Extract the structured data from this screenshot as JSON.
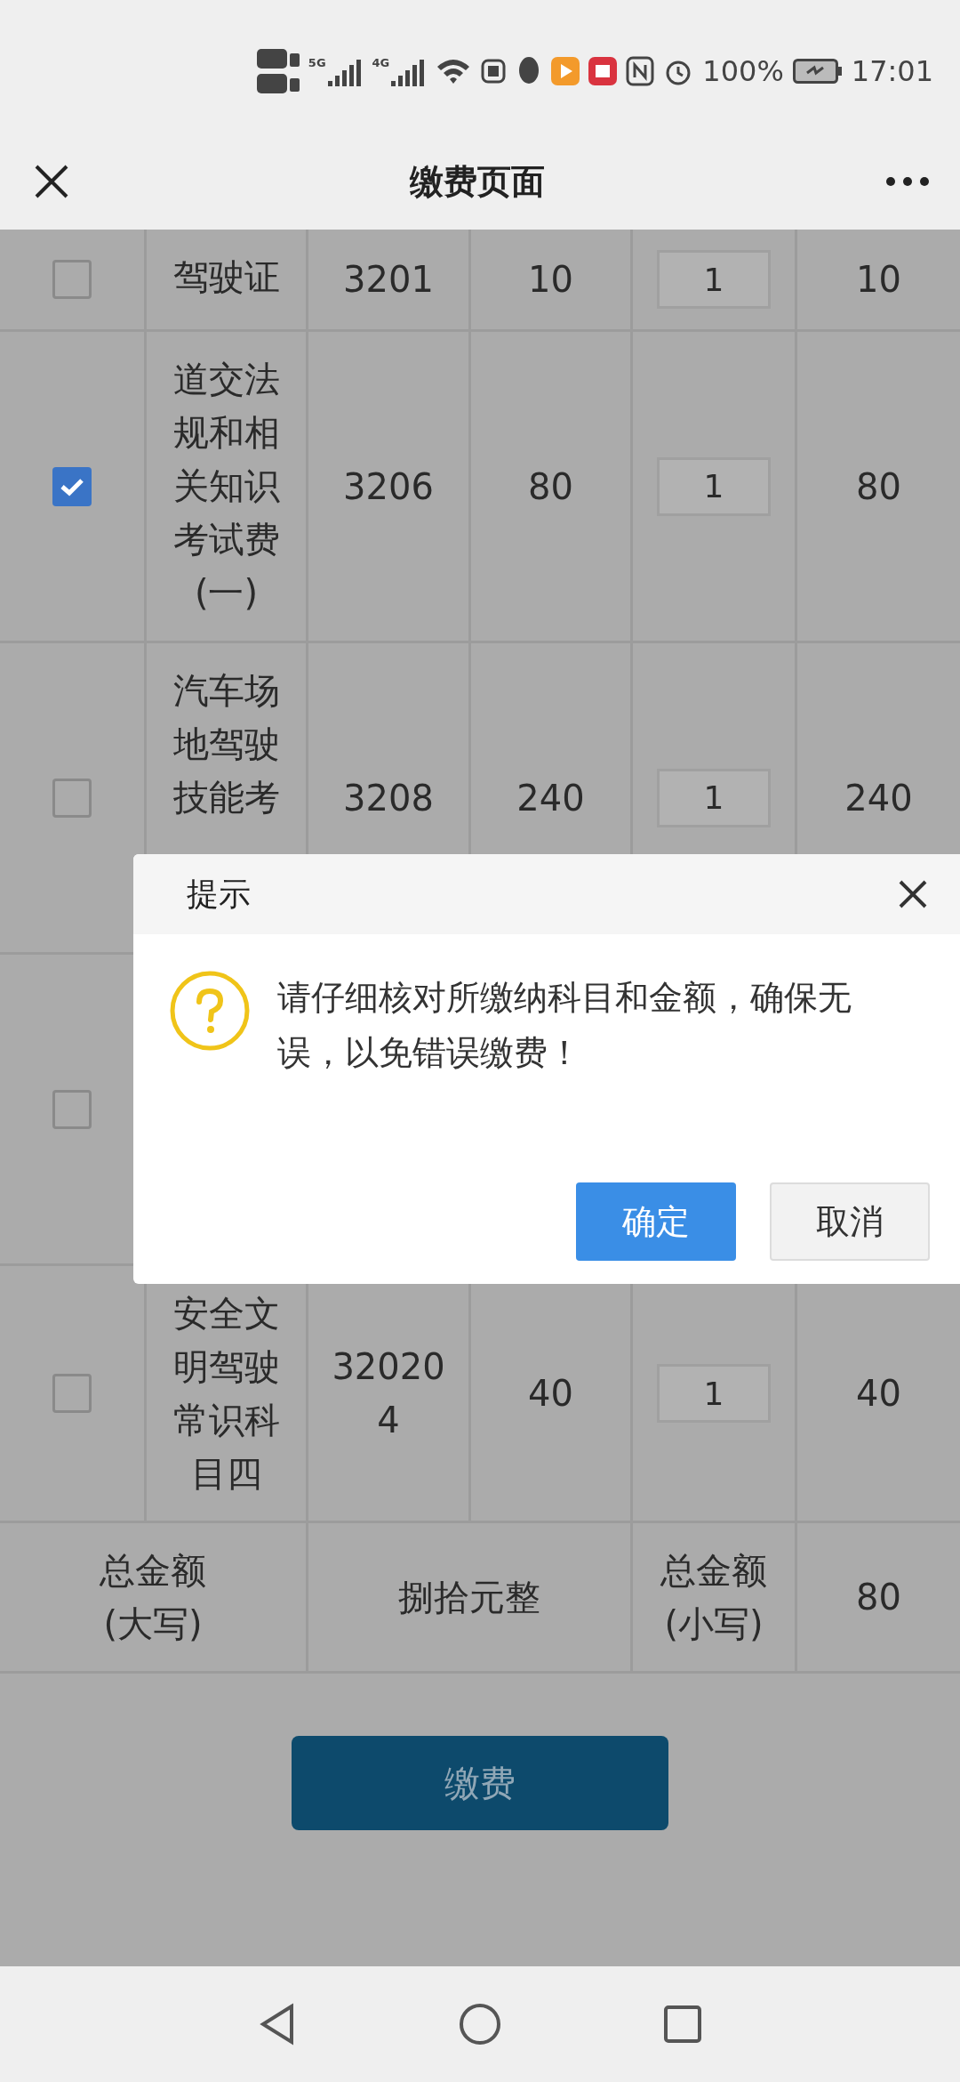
{
  "status_bar": {
    "network_labels": [
      "5G",
      "4G"
    ],
    "battery": "100%",
    "time": "17:01"
  },
  "header": {
    "title": "缴费页面"
  },
  "table": {
    "rows": [
      {
        "checked": false,
        "name": "驾驶证",
        "code": "3201",
        "price": "10",
        "quantity": "1",
        "amount": "10"
      },
      {
        "checked": true,
        "name": "道交法规和相关知识考试费(一)",
        "code": "3206",
        "price": "80",
        "quantity": "1",
        "amount": "80"
      },
      {
        "checked": false,
        "name": "汽车场地驾驶技能考",
        "code": "3208",
        "price": "240",
        "quantity": "1",
        "amount": "240"
      },
      {
        "checked": false
      },
      {
        "checked": false,
        "name": "安全文明驾驶常识科目四",
        "code": "320204",
        "price": "40",
        "quantity": "1",
        "amount": "40"
      }
    ],
    "totals": {
      "uppercase_label": "总金额(大写)",
      "uppercase_value": "捌拾元整",
      "lowercase_label": "总金额(小写)",
      "lowercase_value": "80"
    }
  },
  "pay_button": "缴费",
  "dialog": {
    "title": "提示",
    "message": "请仔细核对所缴纳科目和金额，确保无误，以免错误缴费！",
    "buttons": [
      {
        "label": "确定",
        "kind": "primary"
      },
      {
        "label": "取消",
        "kind": "secondary"
      }
    ]
  }
}
